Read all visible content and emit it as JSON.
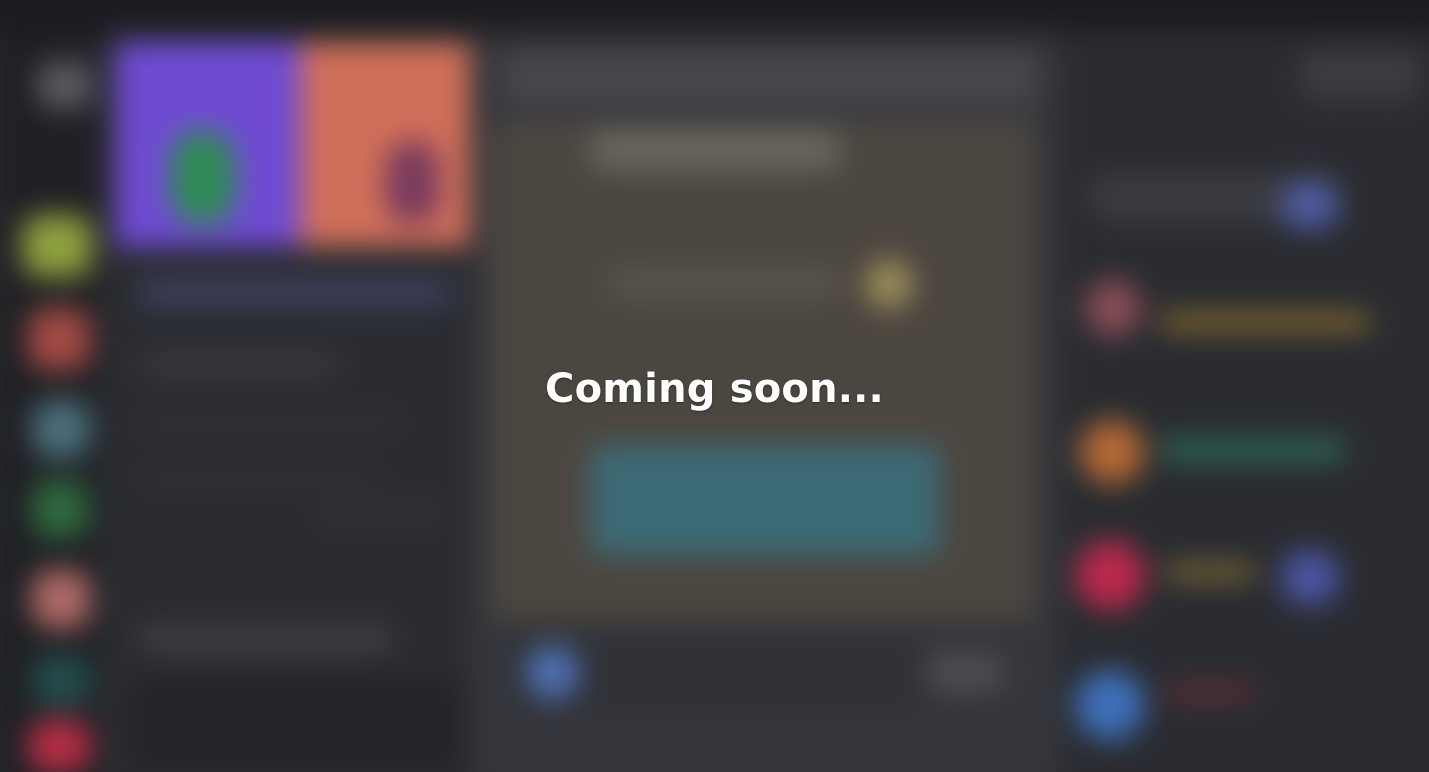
{
  "overlay": {
    "message": "Coming soon..."
  },
  "colors": {
    "page_bg": "#26282c",
    "topbar": "#1b1c20",
    "rail": "#1f2024",
    "panel": "#2a2c31",
    "chat": "#34363b",
    "overlay_text": "#ffffff"
  }
}
